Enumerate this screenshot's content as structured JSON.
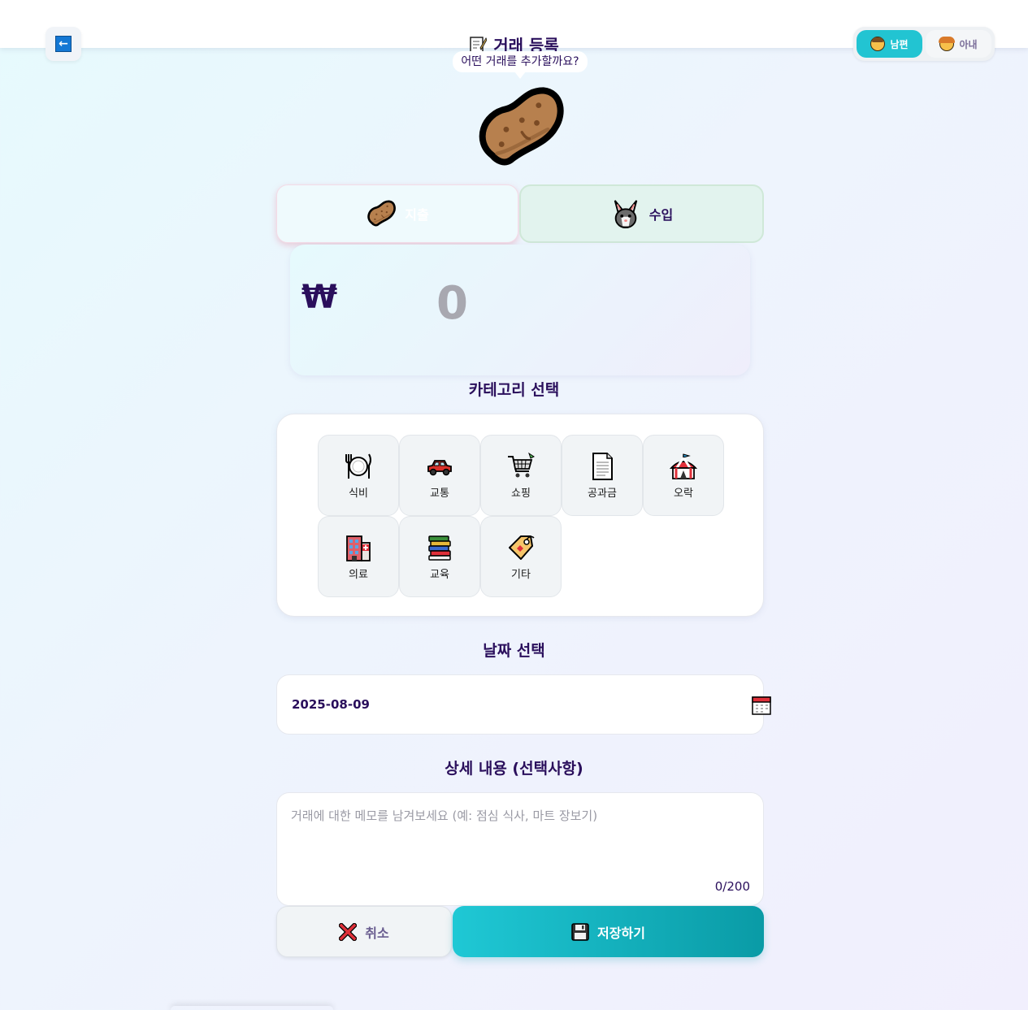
{
  "header": {
    "back_icon": "arrow-left-icon",
    "title_icon": "memo-icon",
    "title": "거래 등록"
  },
  "user_toggle": {
    "options": [
      {
        "label": "남편",
        "icon": "man-face-icon",
        "active": true
      },
      {
        "label": "아내",
        "icon": "woman-face-icon",
        "active": false
      }
    ]
  },
  "mascot": {
    "speech": "어떤 거래를 추가할까요?",
    "icon": "potato-icon"
  },
  "type_tabs": [
    {
      "label": "지출",
      "icon": "potato-icon",
      "active": true
    },
    {
      "label": "수입",
      "icon": "rabbit-icon",
      "active": false
    }
  ],
  "amount": {
    "currency_symbol": "₩",
    "value": "0"
  },
  "category": {
    "section_title": "카테고리 선택",
    "items": [
      {
        "label": "식비",
        "icon": "fork-knife-plate-icon"
      },
      {
        "label": "교통",
        "icon": "car-icon"
      },
      {
        "label": "쇼핑",
        "icon": "shopping-cart-icon"
      },
      {
        "label": "공과금",
        "icon": "document-icon"
      },
      {
        "label": "오락",
        "icon": "circus-tent-icon"
      },
      {
        "label": "의료",
        "icon": "hospital-icon"
      },
      {
        "label": "교육",
        "icon": "books-icon"
      },
      {
        "label": "기타",
        "icon": "tag-icon"
      }
    ]
  },
  "date": {
    "section_title": "날짜 선택",
    "value": "2025-08-09",
    "icon": "calendar-icon"
  },
  "memo": {
    "section_title": "상세 내용 (선택사항)",
    "placeholder": "거래에 대한 메모를 남겨보세요 (예: 점심 식사, 마트 장보기)",
    "value": "",
    "counter": "0/200"
  },
  "actions": {
    "cancel_label": "취소",
    "cancel_icon": "cross-mark-icon",
    "save_label": "저장하기",
    "save_icon": "floppy-disk-icon"
  },
  "colors": {
    "accent": "#22c4d2",
    "save_gradient_start": "#1fc8d5",
    "save_gradient_end": "#0a9ba6",
    "text_primary": "#2a0f5c"
  }
}
